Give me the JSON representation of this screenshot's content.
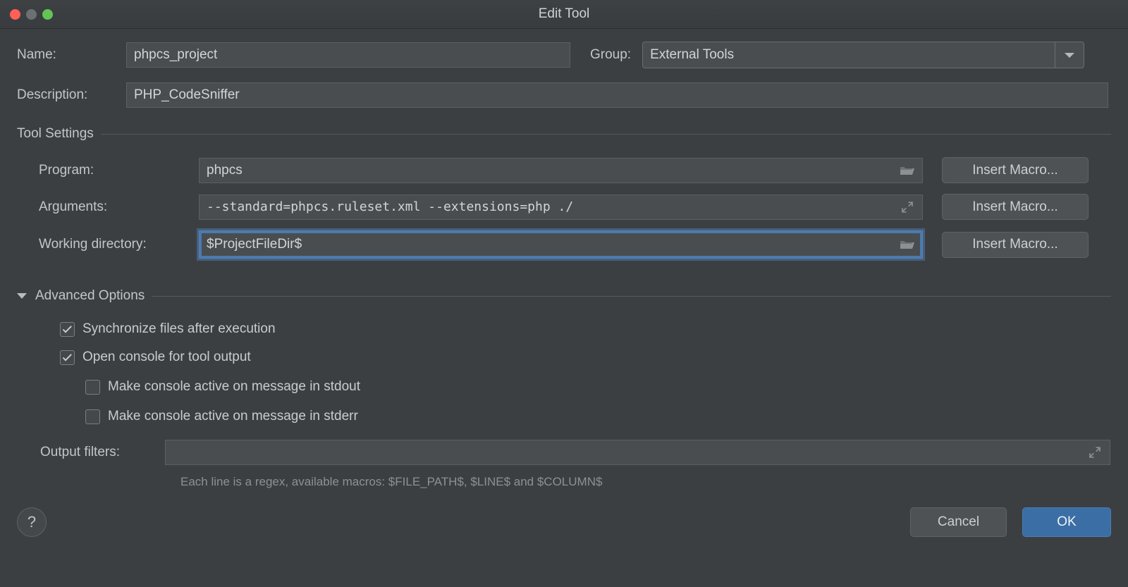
{
  "window": {
    "title": "Edit Tool",
    "traffic_lights": [
      "close",
      "minimize",
      "zoom"
    ],
    "colors": {
      "background": "#3c3f41",
      "field_background": "#4a4d4f",
      "accent_focus": "#4a7ab0",
      "primary_button": "#3b6ea5",
      "close": "#ff5f57",
      "minimize": "#6d7072",
      "zoom": "#62c554"
    }
  },
  "form": {
    "name": {
      "label": "Name:",
      "value": "phpcs_project"
    },
    "group": {
      "label": "Group:",
      "value": "External Tools",
      "dropdown_icon": "chevron-down-icon"
    },
    "description": {
      "label": "Description:",
      "value": "PHP_CodeSniffer"
    }
  },
  "tool_settings": {
    "section_title": "Tool Settings",
    "program": {
      "label": "Program:",
      "value": "phpcs",
      "icon": "folder-icon",
      "macro_button": "Insert Macro..."
    },
    "arguments": {
      "label": "Arguments:",
      "value": "--standard=phpcs.ruleset.xml --extensions=php ./",
      "icon": "expand-icon",
      "macro_button": "Insert Macro..."
    },
    "working_directory": {
      "label": "Working directory:",
      "value": "$ProjectFileDir$",
      "icon": "folder-icon",
      "macro_button": "Insert Macro...",
      "focused": true
    }
  },
  "advanced_options": {
    "section_title": "Advanced Options",
    "expanded": true,
    "disclosure_icon": "triangle-down-icon",
    "checkboxes": [
      {
        "label": "Synchronize files after execution",
        "checked": true,
        "indent": 0
      },
      {
        "label": "Open console for tool output",
        "checked": true,
        "indent": 0
      },
      {
        "label": "Make console active on message in stdout",
        "checked": false,
        "indent": 1
      },
      {
        "label": "Make console active on message in stderr",
        "checked": false,
        "indent": 1
      }
    ],
    "output_filters": {
      "label": "Output filters:",
      "value": "",
      "placeholder": "",
      "icon": "expand-icon"
    },
    "hint": "Each line is a regex, available macros: $FILE_PATH$, $LINE$ and $COLUMN$"
  },
  "footer": {
    "help_label": "?",
    "cancel_label": "Cancel",
    "ok_label": "OK"
  }
}
